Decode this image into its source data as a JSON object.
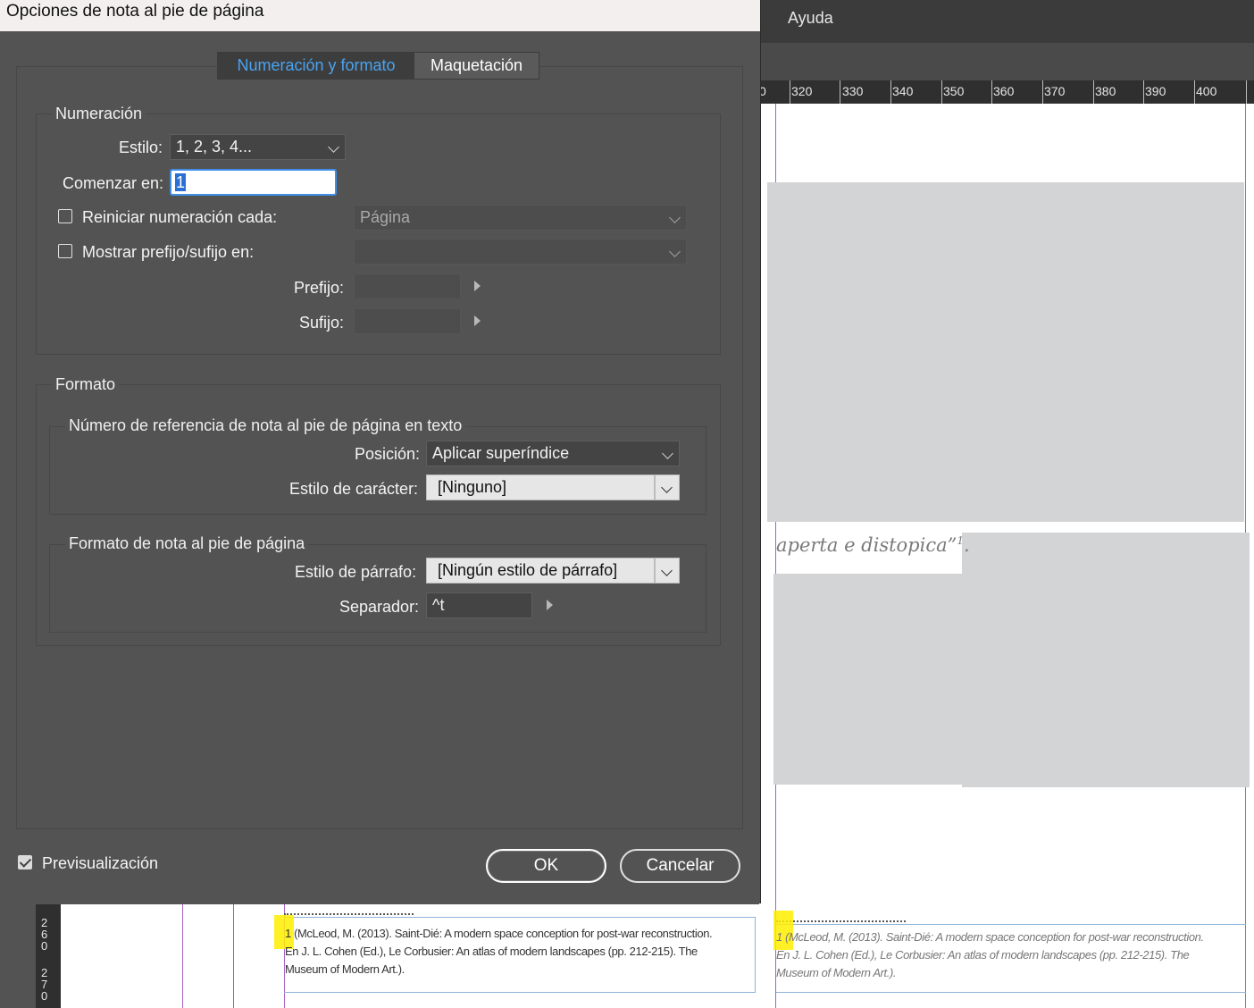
{
  "app": {
    "menu_help": "Ayuda",
    "ruler_labels": [
      "0",
      "320",
      "330",
      "340",
      "350",
      "360",
      "370",
      "380",
      "390",
      "400"
    ],
    "vertical_ruler_labels": [
      "2",
      "6",
      "0",
      "2",
      "7",
      "0"
    ],
    "document": {
      "body_fragment": "aperta e distopica”",
      "body_superscript": "1",
      "body_fragment_end": ".",
      "left_footnote": {
        "number": "1",
        "line1": "(McLeod, M. (2013). Saint-Dié: A modern space conception for post-war reconstruction.",
        "line2": "En J. L. Cohen (Ed.), Le Corbusier: An atlas of modern landscapes (pp. 212-215). The",
        "line3": "Museum of Modern Art.)."
      },
      "right_footnote": {
        "number": "1",
        "line1": "(McLeod, M. (2013). Saint-Dié: A modern space conception for post-war reconstruction.",
        "line2": "En J. L. Cohen (Ed.), Le Corbusier: An atlas of modern landscapes (pp. 212-215). The",
        "line3": "Museum of Modern Art.)."
      }
    }
  },
  "dialog": {
    "title": "Opciones de nota al pie de página",
    "tabs": [
      {
        "label": "Numeración y formato",
        "active": true
      },
      {
        "label": "Maquetación",
        "active": false
      }
    ],
    "numeracion": {
      "group_label": "Numeración",
      "estilo_label": "Estilo:",
      "estilo_value": "1, 2, 3, 4...",
      "comenzar_label": "Comenzar en:",
      "comenzar_value": "1",
      "reiniciar_label": "Reiniciar numeración cada:",
      "reiniciar_checked": false,
      "reiniciar_value": "Página",
      "mostrar_label": "Mostrar prefijo/sufijo en:",
      "mostrar_checked": false,
      "mostrar_value": "",
      "prefijo_label": "Prefijo:",
      "prefijo_value": "",
      "sufijo_label": "Sufijo:",
      "sufijo_value": ""
    },
    "formato": {
      "group_label": "Formato",
      "referencia": {
        "group_label": "Número de referencia de nota al pie de página en texto",
        "posicion_label": "Posición:",
        "posicion_value": "Aplicar superíndice",
        "estilo_caracter_label": "Estilo de carácter:",
        "estilo_caracter_value": "[Ninguno]"
      },
      "nota": {
        "group_label": "Formato de nota al pie de página",
        "estilo_parrafo_label": "Estilo de párrafo:",
        "estilo_parrafo_value": "[Ningún estilo de párrafo]",
        "separador_label": "Separador:",
        "separador_value": "^t"
      }
    },
    "preview_label": "Previsualización",
    "preview_checked": true,
    "ok_label": "OK",
    "cancel_label": "Cancelar"
  }
}
